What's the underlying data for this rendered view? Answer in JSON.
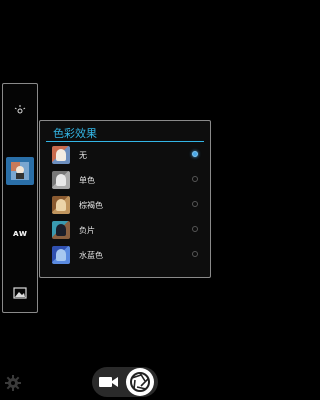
{
  "panel": {
    "title": "色彩效果",
    "options": [
      {
        "label": "无",
        "selected": true
      },
      {
        "label": "单色",
        "selected": false
      },
      {
        "label": "棕褐色",
        "selected": false
      },
      {
        "label": "负片",
        "selected": false
      },
      {
        "label": "水蓝色",
        "selected": false
      }
    ]
  },
  "left_bar": {
    "items": [
      {
        "icon": "brightness-icon"
      },
      {
        "icon": "color-effect-icon",
        "active": true
      },
      {
        "icon": "white-balance-icon",
        "text": "AW"
      },
      {
        "icon": "scene-icon"
      }
    ]
  },
  "colors": {
    "accent": "#33b5e5",
    "active_bg": "#2a6fa8"
  }
}
